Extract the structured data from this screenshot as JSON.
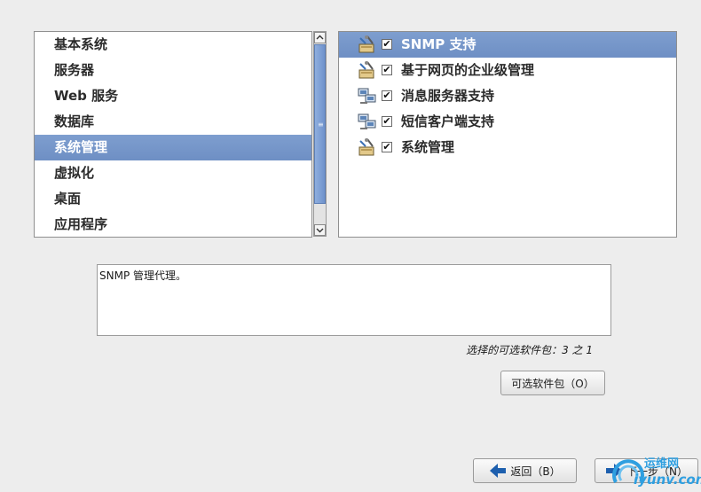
{
  "categories": [
    {
      "label": "基本系统",
      "selected": false
    },
    {
      "label": "服务器",
      "selected": false
    },
    {
      "label": "Web 服务",
      "selected": false
    },
    {
      "label": "数据库",
      "selected": false
    },
    {
      "label": "系统管理",
      "selected": true
    },
    {
      "label": "虚拟化",
      "selected": false
    },
    {
      "label": "桌面",
      "selected": false
    },
    {
      "label": "应用程序",
      "selected": false
    }
  ],
  "packages": [
    {
      "label": "SNMP 支持",
      "checked": true,
      "selected": true,
      "icon": "admin-tools-icon"
    },
    {
      "label": "基于网页的企业级管理",
      "checked": true,
      "selected": false,
      "icon": "admin-tools-icon"
    },
    {
      "label": "消息服务器支持",
      "checked": true,
      "selected": false,
      "icon": "network-server-icon"
    },
    {
      "label": "短信客户端支持",
      "checked": true,
      "selected": false,
      "icon": "network-server-icon"
    },
    {
      "label": "系统管理",
      "checked": true,
      "selected": false,
      "icon": "admin-tools-icon"
    }
  ],
  "description": "SNMP 管理代理。",
  "status": "选择的可选软件包：3 之 1",
  "buttons": {
    "optional": "可选软件包（O）",
    "back": "返回（B）",
    "next": "下一步（N）"
  },
  "watermark": {
    "cn": "运维网",
    "en": "iyunv.com"
  },
  "colors": {
    "selection": "#7393c7",
    "arrow": "#1d5fae",
    "watermark": "#2f9fe0"
  }
}
